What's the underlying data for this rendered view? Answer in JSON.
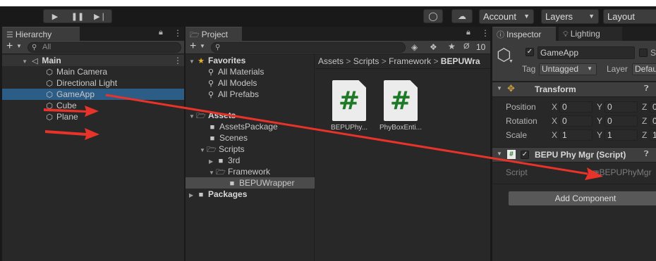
{
  "toolbar": {
    "play_icon": "play-icon",
    "pause_icon": "pause-icon",
    "step_icon": "step-icon",
    "collab_icon": "collab-icon",
    "cloud_icon": "cloud-icon",
    "account_label": "Account",
    "layers_label": "Layers",
    "layout_label": "Layout"
  },
  "hierarchy": {
    "tab_label": "Hierarchy",
    "search_placeholder": "All",
    "items": [
      {
        "label": "Main",
        "icon": "unity-scene-icon"
      },
      {
        "label": "Main Camera",
        "icon": "gameobject-cube-icon"
      },
      {
        "label": "Directional Light",
        "icon": "gameobject-cube-icon"
      },
      {
        "label": "GameApp",
        "icon": "gameobject-cube-icon",
        "selected": true
      },
      {
        "label": "Cube",
        "icon": "gameobject-cube-icon"
      },
      {
        "label": "Plane",
        "icon": "gameobject-cube-icon"
      }
    ]
  },
  "project": {
    "tab_label": "Project",
    "hidden_count": "10",
    "breadcrumb": [
      "Assets",
      "Scripts",
      "Framework",
      "BEPUWra"
    ],
    "tree": {
      "favorites": "Favorites",
      "favorite_items": [
        "All Materials",
        "All Models",
        "All Prefabs"
      ],
      "assets": "Assets",
      "asset_items": [
        "AssetsPackage",
        "Scenes",
        "Scripts"
      ],
      "script_items": [
        "3rd",
        "Framework"
      ],
      "framework_items": [
        "BEPUWrapper"
      ],
      "packages": "Packages"
    },
    "files": [
      {
        "name": "BEPUPhy...",
        "glyph": "#"
      },
      {
        "name": "PhyBoxEnti...",
        "glyph": "#"
      }
    ]
  },
  "inspector": {
    "tab_label": "Inspector",
    "lighting_tab_label": "Lighting",
    "object_name": "GameApp",
    "static_label": "S",
    "tag_label": "Tag",
    "tag_value": "Untagged",
    "layer_label": "Layer",
    "layer_value": "Defau",
    "transform": {
      "title": "Transform",
      "rows": [
        {
          "label": "Position",
          "x": "0",
          "y": "0",
          "z": "0"
        },
        {
          "label": "Rotation",
          "x": "0",
          "y": "0",
          "z": "0"
        },
        {
          "label": "Scale",
          "x": "1",
          "y": "1",
          "z": "1"
        }
      ]
    },
    "component": {
      "title": "BEPU Phy Mgr (Script)",
      "script_label": "Script",
      "script_value": "BEPUPhyMgr"
    },
    "add_component_label": "Add Component"
  },
  "colors": {
    "annotation_arrow": "#e8332a",
    "selection": "#2c5d87",
    "script_icon_green": "#1f7a27"
  }
}
